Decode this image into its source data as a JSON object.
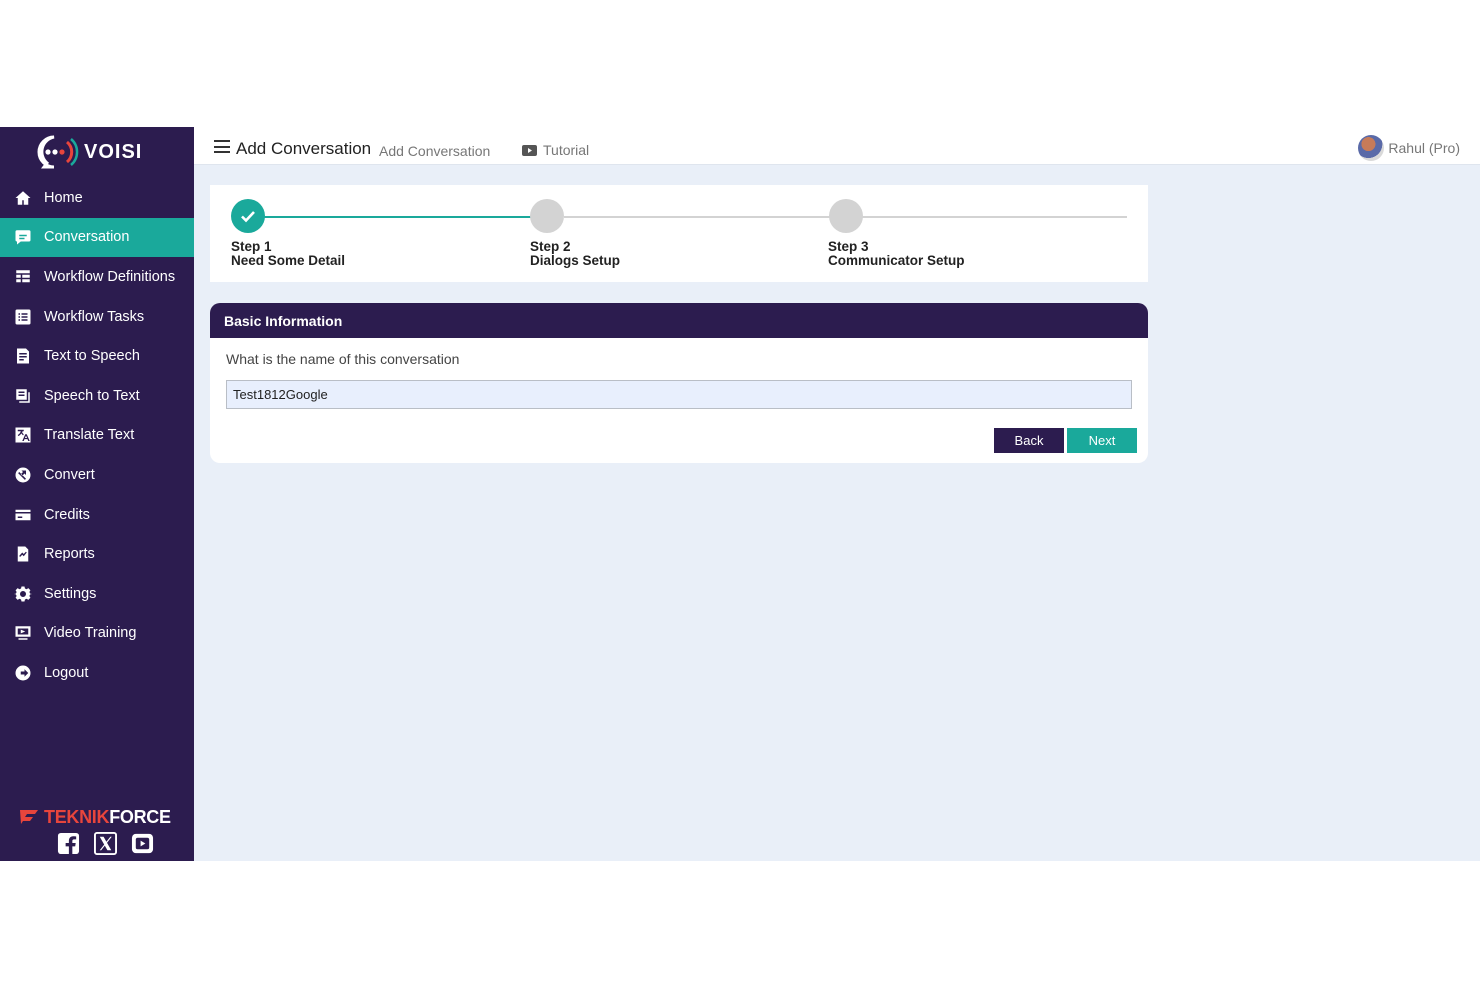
{
  "app": {
    "logo_text": "VOISI"
  },
  "sidebar": {
    "items": [
      {
        "label": "Home",
        "icon": "home-icon",
        "active": false
      },
      {
        "label": "Conversation",
        "icon": "chat-icon",
        "active": true
      },
      {
        "label": "Workflow Definitions",
        "icon": "workflow-definitions-icon",
        "active": false
      },
      {
        "label": "Workflow Tasks",
        "icon": "tasks-icon",
        "active": false
      },
      {
        "label": "Text to Speech",
        "icon": "text-to-speech-icon",
        "active": false
      },
      {
        "label": "Speech to Text",
        "icon": "speech-to-text-icon",
        "active": false
      },
      {
        "label": "Translate Text",
        "icon": "translate-icon",
        "active": false
      },
      {
        "label": "Convert",
        "icon": "convert-icon",
        "active": false
      },
      {
        "label": "Credits",
        "icon": "credit-card-icon",
        "active": false
      },
      {
        "label": "Reports",
        "icon": "reports-icon",
        "active": false
      },
      {
        "label": "Settings",
        "icon": "gear-icon",
        "active": false
      },
      {
        "label": "Video Training",
        "icon": "video-icon",
        "active": false
      },
      {
        "label": "Logout",
        "icon": "logout-icon",
        "active": false
      }
    ],
    "footer_brand_part1": "TEKNIK",
    "footer_brand_part2": "FORCE",
    "social": [
      "facebook-icon",
      "x-icon",
      "youtube-icon"
    ]
  },
  "header": {
    "title": "Add Conversation",
    "breadcrumb": "Add Conversation",
    "tutorial_label": "Tutorial",
    "user_label": "Rahul (Pro)"
  },
  "stepper": {
    "steps": [
      {
        "step": "Step 1",
        "name": "Need Some Detail",
        "state": "complete"
      },
      {
        "step": "Step 2",
        "name": "Dialogs Setup",
        "state": "pending"
      },
      {
        "step": "Step 3",
        "name": "Communicator Setup",
        "state": "pending"
      }
    ]
  },
  "basic_info": {
    "heading": "Basic Information",
    "question": "What is the name of this conversation",
    "name_value": "Test1812Google",
    "back_label": "Back",
    "next_label": "Next"
  },
  "colors": {
    "sidebar": "#2c1c4f",
    "accent": "#1aa99b",
    "background": "#e9eff8"
  }
}
